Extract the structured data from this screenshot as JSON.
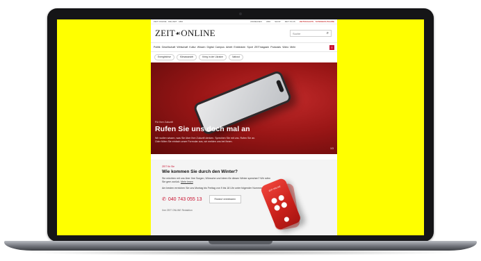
{
  "topbar": {
    "left": "ZEIT ONLINE · DIE ZEIT · ABO",
    "links": [
      "ANMELDEN",
      "ABO",
      "SHOP",
      "ZEIT PLUS"
    ],
    "highlight": "ZEITMAGAZIN · SONDERAUSGABE"
  },
  "masthead": {
    "logo_left": "ZEIT",
    "logo_crest": "☙",
    "logo_right": "ONLINE",
    "search_placeholder": "Suche",
    "search_icon": "magnifier-icon"
  },
  "nav": {
    "items": [
      "Politik",
      "Gesellschaft",
      "Wirtschaft",
      "Kultur",
      "Wissen",
      "Digital",
      "Campus",
      "Arbeit",
      "Entdecken",
      "Sport",
      "ZEITmagazin",
      "Podcasts",
      "Video",
      "Mehr"
    ],
    "more_label": "≡",
    "accent": "#c8102e"
  },
  "chips": [
    "Energiekrise",
    "Klimawandel",
    "Krieg in der Ukraine",
    "Nahost"
  ],
  "hero": {
    "kicker": "Für Ihre Zukunft",
    "title": "Rufen Sie uns doch mal an",
    "teaser_1": "Wir wollen wissen, was Sie über Ihre Zukunft denken. Sprechen Sie mit uns. Rufen Sie an.",
    "teaser_2": "Oder füllen Sie einfach unser Formular aus, wir melden uns bei Ihnen.",
    "count": "1/3"
  },
  "promo": {
    "kicker": "ZEIT für Sie",
    "title": "Wie kommen Sie durch den Winter?",
    "paragraph_1": "Sie möchten mit uns über Ihre Sorgen, Wünsche und Ideen für diesen Winter sprechen? Wir rufen Sie gern zurück.",
    "link_label": "Mehr lesen",
    "paragraph_2": "Am besten erreichen Sie uns Montag bis Freitag von 9 bis 18 Uhr unter folgender Nummer:",
    "phone_icon": "phone-icon",
    "phone_number": "040 743 055 13",
    "callback_label": "Rückruf vereinbaren",
    "footer": "Ihre ZEIT ONLINE Redaktion",
    "device_brand": "ZEIT ONLINE"
  },
  "colors": {
    "screen_background": "#ffff00",
    "hero_red": "#9a1616",
    "accent_red": "#c8102e"
  }
}
